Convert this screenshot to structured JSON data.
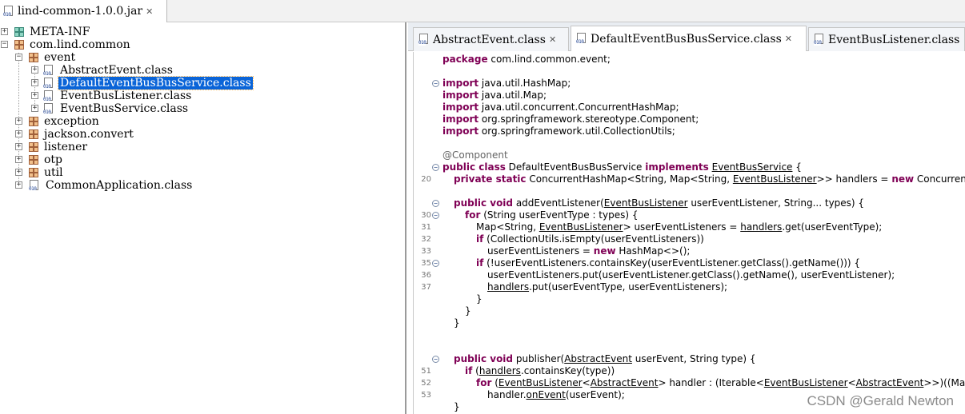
{
  "jar_tab": {
    "label": "lind-common-1.0.0.jar"
  },
  "tree": {
    "meta_inf": "META-INF",
    "root_package": "com.lind.common",
    "event": "event",
    "classes": [
      "AbstractEvent.class",
      "DefaultEventBusBusService.class",
      "EventBusListener.class",
      "EventBusService.class"
    ],
    "packages": [
      "exception",
      "jackson.convert",
      "listener",
      "otp",
      "util"
    ],
    "main_class": "CommonApplication.class",
    "selected": "DefaultEventBusBusService.class"
  },
  "editor_tabs": [
    {
      "label": "AbstractEvent.class"
    },
    {
      "label": "DefaultEventBusBusService.class"
    },
    {
      "label": "EventBusListener.class"
    }
  ],
  "code": {
    "package_line": [
      {
        "kw": "package"
      },
      {
        "t": " com.lind.common.event;"
      }
    ],
    "imports": [
      [
        {
          "kw": "import"
        },
        {
          "t": " java.util.HashMap;"
        }
      ],
      [
        {
          "kw": "import"
        },
        {
          "t": " java.util.Map;"
        }
      ],
      [
        {
          "kw": "import"
        },
        {
          "t": " java.util.concurrent.ConcurrentHashMap;"
        }
      ],
      [
        {
          "kw": "import"
        },
        {
          "t": " org.springframework.stereotype.Component;"
        }
      ],
      [
        {
          "kw": "import"
        },
        {
          "t": " org.springframework.util.CollectionUtils;"
        }
      ]
    ],
    "annotation": "@Component",
    "class_decl": [
      {
        "kw": "public class"
      },
      {
        "t": " DefaultEventBusBusService "
      },
      {
        "kw": "implements"
      },
      {
        "t": " "
      },
      {
        "u": "EventBusService"
      },
      {
        "t": " {"
      }
    ],
    "field_line": [
      {
        "kw": "private static"
      },
      {
        "t": " ConcurrentHashMap<String, Map<String, "
      },
      {
        "u": "EventBusListener"
      },
      {
        "t": ">> handlers = "
      },
      {
        "kw": "new"
      },
      {
        "t": " ConcurrentHashMap<>();"
      }
    ],
    "field_line_no": "20",
    "method1": [
      {
        "no": "",
        "fold": true,
        "indent": 1,
        "p": [
          {
            "kw": "public void"
          },
          {
            "t": " addEventListener("
          },
          {
            "u": "EventBusListener"
          },
          {
            "t": " userEventListener, String... types) {"
          }
        ]
      },
      {
        "no": "30",
        "fold": true,
        "indent": 2,
        "p": [
          {
            "kw": "for"
          },
          {
            "t": " (String userEventType : types) {"
          }
        ]
      },
      {
        "no": "31",
        "fold": false,
        "indent": 3,
        "p": [
          {
            "t": "Map<String, "
          },
          {
            "u": "EventBusListener"
          },
          {
            "t": "> userEventListeners = "
          },
          {
            "u": "handlers"
          },
          {
            "t": ".get(userEventType);"
          }
        ]
      },
      {
        "no": "32",
        "fold": false,
        "indent": 3,
        "p": [
          {
            "kw": "if"
          },
          {
            "t": " (CollectionUtils.isEmpty(userEventListeners))"
          }
        ]
      },
      {
        "no": "33",
        "fold": false,
        "indent": 4,
        "p": [
          {
            "t": "userEventListeners = "
          },
          {
            "kw": "new"
          },
          {
            "t": " HashMap<>();"
          }
        ]
      },
      {
        "no": "35",
        "fold": true,
        "indent": 3,
        "p": [
          {
            "kw": "if"
          },
          {
            "t": " (!userEventListeners.containsKey(userEventListener.getClass().getName())) {"
          }
        ]
      },
      {
        "no": "36",
        "fold": false,
        "indent": 4,
        "p": [
          {
            "t": "userEventListeners.put(userEventListener.getClass().getName(), userEventListener);"
          }
        ]
      },
      {
        "no": "37",
        "fold": false,
        "indent": 4,
        "p": [
          {
            "u": "handlers"
          },
          {
            "t": ".put(userEventType, userEventListeners);"
          }
        ]
      },
      {
        "no": "",
        "fold": false,
        "indent": 3,
        "p": [
          {
            "t": "}"
          }
        ]
      },
      {
        "no": "",
        "fold": false,
        "indent": 2,
        "p": [
          {
            "t": "}"
          }
        ]
      },
      {
        "no": "",
        "fold": false,
        "indent": 1,
        "p": [
          {
            "t": "}"
          }
        ]
      }
    ],
    "method2": [
      {
        "no": "",
        "fold": true,
        "indent": 1,
        "p": [
          {
            "kw": "public void"
          },
          {
            "t": " publisher("
          },
          {
            "u": "AbstractEvent"
          },
          {
            "t": " userEvent, String type) {"
          }
        ]
      },
      {
        "no": "51",
        "fold": false,
        "indent": 2,
        "p": [
          {
            "kw": "if"
          },
          {
            "t": " ("
          },
          {
            "u": "handlers"
          },
          {
            "t": ".containsKey(type))"
          }
        ]
      },
      {
        "no": "52",
        "fold": false,
        "indent": 3,
        "p": [
          {
            "kw": "for"
          },
          {
            "t": " ("
          },
          {
            "u": "EventBusListener"
          },
          {
            "t": "<"
          },
          {
            "u": "AbstractEvent"
          },
          {
            "t": "> handler : (Iterable<"
          },
          {
            "u": "EventBusListener"
          },
          {
            "t": "<"
          },
          {
            "u": "AbstractEvent"
          },
          {
            "t": ">>)((Map)"
          }
        ]
      },
      {
        "no": "53",
        "fold": false,
        "indent": 4,
        "p": [
          {
            "t": "handler."
          },
          {
            "u": "onEvent"
          },
          {
            "t": "(userEvent);"
          }
        ]
      },
      {
        "no": "",
        "fold": false,
        "indent": 1,
        "p": [
          {
            "t": "}"
          }
        ]
      },
      {
        "no": "",
        "fold": false,
        "indent": 0,
        "p": [
          {
            "t": "}"
          }
        ]
      }
    ]
  },
  "watermark": "CSDN @Gerald Newton"
}
